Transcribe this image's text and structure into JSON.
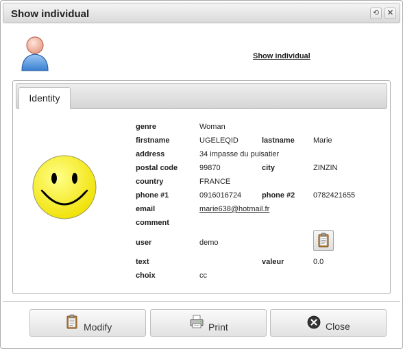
{
  "window": {
    "title": "Show individual",
    "refresh_glyph": "⟲",
    "close_glyph": "✕"
  },
  "header": {
    "avatar_icon": "user-icon",
    "link_text": "Show individual"
  },
  "tabs": [
    {
      "label": "Identity",
      "active": true
    }
  ],
  "photo_icon": "smiley-face-icon",
  "fields": {
    "genre": {
      "label": "genre",
      "value": "Woman"
    },
    "firstname": {
      "label": "firstname",
      "value": "UGELEQID"
    },
    "lastname": {
      "label": "lastname",
      "value": "Marie"
    },
    "address": {
      "label": "address",
      "value": "34 impasse du puisatier"
    },
    "postal_code": {
      "label": "postal code",
      "value": "99870"
    },
    "city": {
      "label": "city",
      "value": "ZINZIN"
    },
    "country": {
      "label": "country",
      "value": "FRANCE"
    },
    "phone1": {
      "label": "phone #1",
      "value": "0916016724"
    },
    "phone2": {
      "label": "phone #2",
      "value": "0782421655"
    },
    "email": {
      "label": "email",
      "value": "marie638@hotmail.fr"
    },
    "comment": {
      "label": "comment",
      "value": ""
    },
    "user": {
      "label": "user",
      "value": "demo"
    },
    "text": {
      "label": "text",
      "value": ""
    },
    "valeur": {
      "label": "valeur",
      "value": "0.0"
    },
    "choix": {
      "label": "choix",
      "value": "cc"
    }
  },
  "buttons": {
    "modify": {
      "label": "Modify",
      "icon": "clipboard-icon"
    },
    "print": {
      "label": "Print",
      "icon": "printer-icon"
    },
    "close": {
      "label": "Close",
      "icon": "close-circle-icon"
    }
  },
  "colors": {
    "smiley_fill": "#ffff00",
    "avatar_body": "#5b9be0",
    "avatar_head": "#f3b6a3"
  }
}
